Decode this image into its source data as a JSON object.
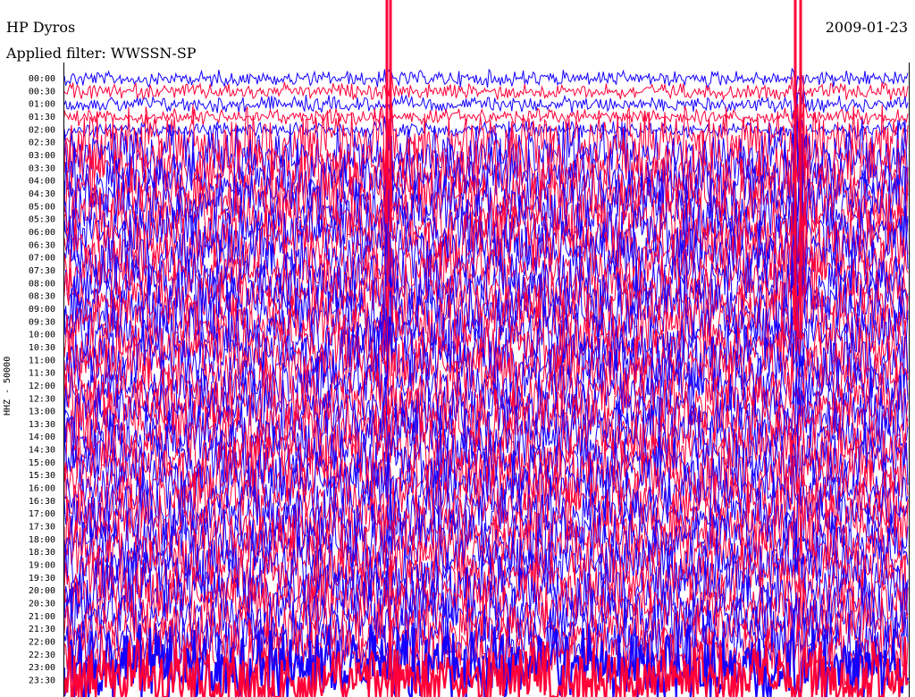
{
  "header": {
    "station": "HP Dyros",
    "date": "2009-01-23",
    "filter": "Applied filter: WWSSN-SP"
  },
  "chart_data": {
    "type": "line",
    "title": "HP Dyros",
    "subtitle": "Applied filter: WWSSN-SP",
    "ylabel": "HHZ - 50000",
    "xlabel": "",
    "row_labels": [
      "00:00",
      "00:30",
      "01:00",
      "01:30",
      "02:00",
      "02:30",
      "03:00",
      "03:30",
      "04:00",
      "04:30",
      "05:00",
      "05:30",
      "06:00",
      "06:30",
      "07:00",
      "07:30",
      "08:00",
      "08:30",
      "09:00",
      "09:30",
      "10:00",
      "10:30",
      "11:00",
      "11:30",
      "12:00",
      "12:30",
      "13:00",
      "13:30",
      "14:00",
      "14:30",
      "15:00",
      "15:30",
      "16:00",
      "16:30",
      "17:00",
      "17:30",
      "18:00",
      "18:30",
      "19:00",
      "19:30",
      "20:00",
      "20:30",
      "21:00",
      "21:30",
      "22:00",
      "22:30",
      "23:00",
      "23:30"
    ],
    "series_colors": [
      "#1500ff",
      "#ff0039"
    ],
    "grid": false,
    "legend": "none"
  }
}
